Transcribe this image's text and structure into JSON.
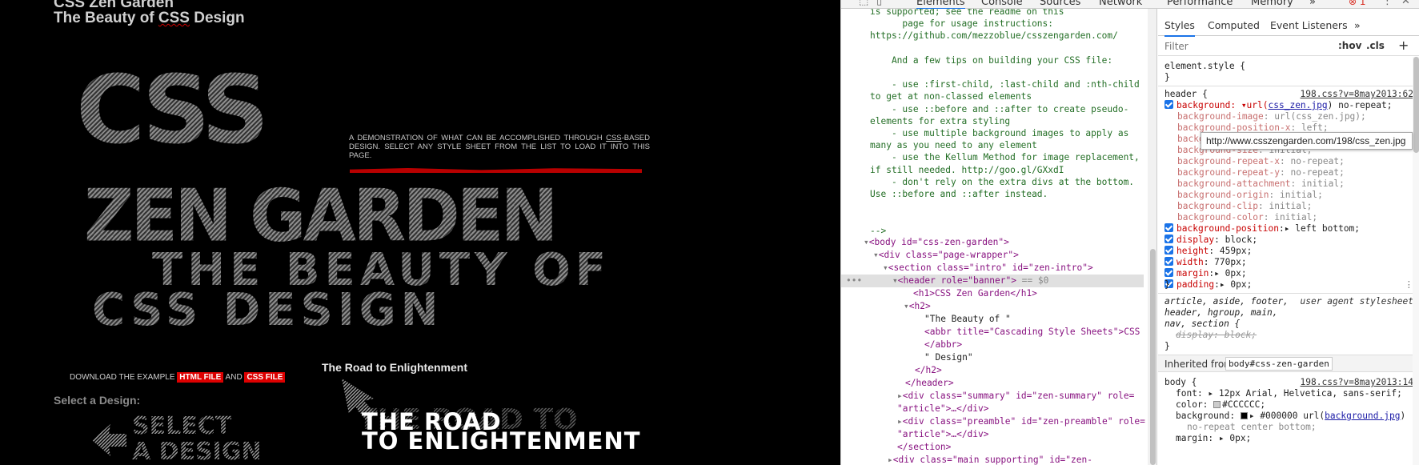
{
  "viewport": {
    "h1": "CSS Zen Garden",
    "h2_pre": "The Beauty of ",
    "h2_abbr": "CSS",
    "h2_post": " Design",
    "banner": {
      "line1": "CSS",
      "line2": "ZEN GARDEN",
      "line3": "THE BEAUTY OF",
      "line4": "CSS DESIGN"
    },
    "summary_pre": "A demonstration of what can be accomplished through ",
    "summary_link": "CSS",
    "summary_post": "-based design. Select any style sheet from the list to load it into this page.",
    "download_pre": "DOWNLOAD THE EXAMPLE ",
    "download_html": "HTML FILE",
    "download_and": " AND ",
    "download_css": "CSS FILE",
    "road_title": "The Road to Enlightenment",
    "select_label": "Select a Design:",
    "select_graphic": "SELECT A DESIGN",
    "road_graphic_top": "THE ROAD TO",
    "road_graphic_big1": "THE ROAD",
    "road_graphic_big2": "TO ENLIGHTENMENT"
  },
  "devtools": {
    "tabs": [
      "Elements",
      "Console",
      "Sources",
      "Network",
      "Performance",
      "Memory"
    ],
    "active_tab": "Elements",
    "overflow": "»",
    "error_count": "1",
    "dom_lines": [
      "is supported; see the readme on this",
      "      page for usage instructions:",
      "https://github.com/mezzoblue/csszengarden.com/",
      "",
      "    And a few tips on building your CSS file:",
      "",
      "    - use :first-child, :last-child and :nth-child",
      "to get at non-classed elements",
      "    - use ::before and ::after to create pseudo-",
      "elements for extra styling",
      "    - use multiple background images to apply as",
      "many as you need to any element",
      "    - use the Kellum Method for image replacement,",
      "if still needed. http://goo.gl/GXxdI",
      "    - don't rely on the extra divs at the bottom.",
      "Use ::before and ::after instead.",
      "",
      "",
      "-->"
    ],
    "dom_tree": {
      "body": "<body id=\"css-zen-garden\">",
      "page_wrapper": "<div class=\"page-wrapper\">",
      "section": "<section class=\"intro\" id=\"zen-intro\">",
      "header": "<header role=\"banner\">",
      "header_suffix": " == $0",
      "h1": "<h1>CSS Zen Garden</h1>",
      "h2_open": "<h2>",
      "h2_text": "\"The Beauty of \"",
      "abbr": "<abbr title=\"Cascading Style Sheets\">CSS",
      "abbr_close": "</abbr>",
      "design": "\" Design\"",
      "h2_close": "</h2>",
      "header_close": "</header>",
      "summary_a": "<div class=\"summary\" id=\"zen-summary\" role=",
      "summary_b": "\"article\">…</div>",
      "preamble_a": "<div class=\"preamble\" id=\"zen-preamble\" role=",
      "preamble_b": "\"article\">…</div>",
      "section_close": "</section>",
      "main_a": "<div class=\"main supporting\" id=\"zen-"
    },
    "styles_tabs": [
      "Styles",
      "Computed",
      "Event Listeners"
    ],
    "styles_overflow": "»",
    "filter_placeholder": "Filter",
    "hov": ":hov",
    "cls": ".cls",
    "plus": "+",
    "element_style": "element.style {",
    "close_brace": "}",
    "header_rule": "header {",
    "header_src": "198.css?v=8may2013:62",
    "bg_decl": "background: ▾url(",
    "bg_url": "css_zen.jpg",
    "bg_tail": ") no-repeat;",
    "longhands": [
      {
        "p": "background-image",
        "v": "url(css_zen.jpg);"
      },
      {
        "p": "background-position-x",
        "v": "left;"
      },
      {
        "p": "background-position-y",
        "v": ""
      },
      {
        "p": "background-size",
        "v": "initial;"
      },
      {
        "p": "background-repeat-x",
        "v": "no-repeat;"
      },
      {
        "p": "background-repeat-y",
        "v": "no-repeat;"
      },
      {
        "p": "background-attachment",
        "v": "initial;"
      },
      {
        "p": "background-origin",
        "v": "initial;"
      },
      {
        "p": "background-clip",
        "v": "initial;"
      },
      {
        "p": "background-color",
        "v": "initial;"
      }
    ],
    "decls": [
      {
        "p": "background-position",
        "v": "▸ left bottom;"
      },
      {
        "p": "display",
        "v": " block;"
      },
      {
        "p": "height",
        "v": " 459px;"
      },
      {
        "p": "width",
        "v": " 770px;"
      },
      {
        "p": "margin",
        "v": "▸ 0px;"
      },
      {
        "p": "padding",
        "v": "▸ 0px;"
      }
    ],
    "ua_selector_1": "article, aside, footer,",
    "ua_label": "user agent stylesheet",
    "ua_selector_2": "header, hgroup, main,",
    "ua_selector_3": "nav, section {",
    "ua_display": "display: block;",
    "inherited_label": "Inherited from",
    "inherited_from": "body#css-zen-garden",
    "body_rule": "body {",
    "body_src": "198.css?v=8may2013:14",
    "body_font": "font: ▸ 12px Arial, Helvetica, sans-serif;",
    "body_color_p": "color:",
    "body_color_v": "#CCCCCC;",
    "body_bg_p": "background:",
    "body_bg_v": "▸ #000000 url(",
    "body_bg_url": "background.jpg",
    "body_bg_tail": ")",
    "body_bg_line2": "no-repeat center bottom;",
    "body_margin": "margin: ▸ 0px;",
    "tooltip": "http://www.csszengarden.com/198/css_zen.jpg"
  },
  "colors": {
    "accent": "#1a73e8",
    "prop": "#c80000",
    "tag": "#881280",
    "attr": "#994500",
    "attrval": "#1a1aa6",
    "brand_red": "#d00000"
  }
}
